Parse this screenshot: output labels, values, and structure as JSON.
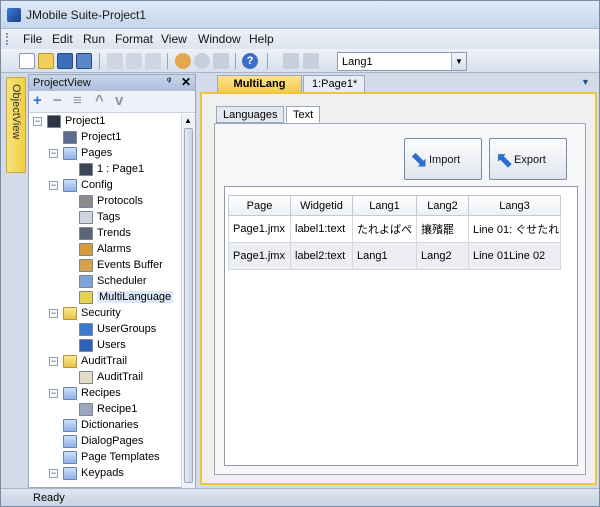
{
  "window": {
    "title": "JMobile Suite-Project1"
  },
  "menu": [
    "File",
    "Edit",
    "Run",
    "Format",
    "View",
    "Window",
    "Help"
  ],
  "toolbar": {
    "project_select": "Lang1"
  },
  "sidebar_tab": "ObjectView",
  "project_view": {
    "title": "ProjectView",
    "pin": "ᵠ",
    "close": "✕",
    "tools": [
      "+",
      "−",
      "≡",
      "^",
      "v"
    ],
    "tree": [
      {
        "label": "Project1",
        "expand": "−",
        "icon": "computer-icon"
      },
      {
        "label": "Project1",
        "expand": "",
        "icon": "project-settings-icon"
      },
      {
        "label": "Pages",
        "expand": "−",
        "icon": "folder-icon"
      },
      {
        "label": "1 : Page1",
        "expand": "",
        "icon": "page-icon"
      },
      {
        "label": "Config",
        "expand": "−",
        "icon": "folder-icon"
      },
      {
        "label": "Protocols",
        "expand": "",
        "icon": "protocols-icon"
      },
      {
        "label": "Tags",
        "expand": "",
        "icon": "tags-icon"
      },
      {
        "label": "Trends",
        "expand": "",
        "icon": "trends-icon"
      },
      {
        "label": "Alarms",
        "expand": "",
        "icon": "alarms-icon"
      },
      {
        "label": "Events Buffer",
        "expand": "",
        "icon": "events-buffer-icon"
      },
      {
        "label": "Scheduler",
        "expand": "",
        "icon": "scheduler-icon"
      },
      {
        "label": "MultiLanguage",
        "expand": "",
        "icon": "multilanguage-icon"
      },
      {
        "label": "Security",
        "expand": "−",
        "icon": "security-folder-icon"
      },
      {
        "label": "UserGroups",
        "expand": "",
        "icon": "usergroups-icon"
      },
      {
        "label": "Users",
        "expand": "",
        "icon": "users-icon"
      },
      {
        "label": "AuditTrail",
        "expand": "−",
        "icon": "audittrail-folder-icon"
      },
      {
        "label": "AuditTrail",
        "expand": "",
        "icon": "audittrail-icon"
      },
      {
        "label": "Recipes",
        "expand": "−",
        "icon": "folder-icon"
      },
      {
        "label": "Recipe1",
        "expand": "",
        "icon": "recipe-icon"
      },
      {
        "label": "Dictionaries",
        "expand": "",
        "icon": "folder-icon"
      },
      {
        "label": "DialogPages",
        "expand": "",
        "icon": "folder-icon"
      },
      {
        "label": "Page Templates",
        "expand": "",
        "icon": "folder-icon"
      },
      {
        "label": "Keypads",
        "expand": "−",
        "icon": "folder-icon"
      }
    ]
  },
  "doc_tabs": [
    {
      "label": "MultiLang",
      "active": true
    },
    {
      "label": "1:Page1*",
      "active": false
    }
  ],
  "inner_tabs": [
    {
      "label": "Languages",
      "selected": false
    },
    {
      "label": "Text",
      "selected": true
    }
  ],
  "buttons": {
    "import": "Import",
    "export": "Export"
  },
  "grid": {
    "columns": [
      "Page",
      "Widgetid",
      "Lang1",
      "Lang2",
      "Lang3"
    ],
    "rows": [
      [
        "Page1.jmx",
        "label1:text",
        "たれよばぺ",
        "攘殯罷",
        "Line 01: ぐせたれ..."
      ],
      [
        "Page1.jmx",
        "label2:text",
        "Lang1",
        "Lang2",
        "Line 01Line 02"
      ]
    ]
  },
  "status": "Ready",
  "colors": {
    "accent": "#f3cb4b",
    "header": "#aebfdb",
    "frame": "#d4dbe8"
  }
}
